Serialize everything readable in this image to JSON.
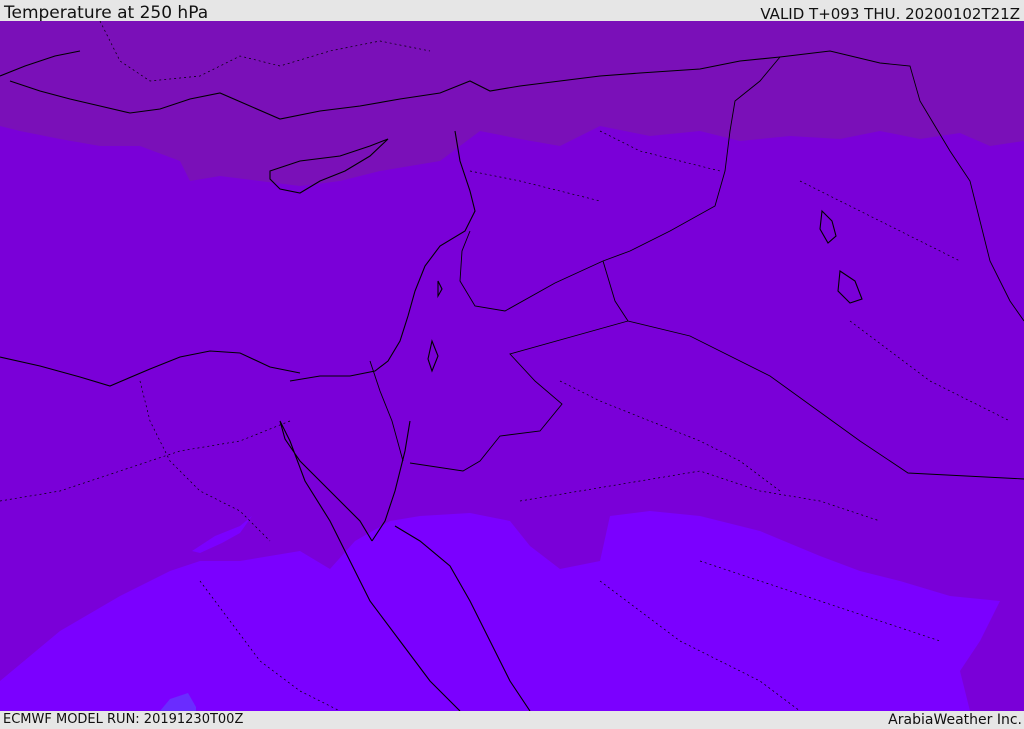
{
  "header": {
    "title": "Temperature at 250 hPa",
    "valid": "VALID T+093 THU. 20200102T21Z"
  },
  "footer": {
    "model_run": "ECMWF MODEL RUN: 20191230T00Z",
    "credit": "ArabiaWeather Inc."
  },
  "colors": {
    "band_cold": "#7a10b8",
    "band_mid": "#7a00d8",
    "band_warm": "#7b00ff",
    "band_warmest": "#6a2cff",
    "coast": "#000000",
    "frame": "#e6e6e6"
  }
}
